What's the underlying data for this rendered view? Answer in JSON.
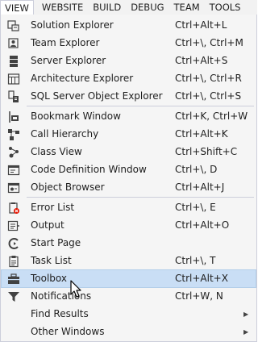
{
  "menubar": {
    "view": "VIEW",
    "website": "WEBSITE",
    "build": "BUILD",
    "debug": "DEBUG",
    "team": "TEAM",
    "tools": "TOOLS"
  },
  "menu": {
    "items": [
      {
        "label": "Solution Explorer",
        "shortcut": "Ctrl+Alt+L",
        "icon": "solution-explorer-icon"
      },
      {
        "label": "Team Explorer",
        "shortcut": "Ctrl+\\, Ctrl+M",
        "icon": "team-explorer-icon"
      },
      {
        "label": "Server Explorer",
        "shortcut": "Ctrl+Alt+S",
        "icon": "server-explorer-icon"
      },
      {
        "label": "Architecture Explorer",
        "shortcut": "Ctrl+\\, Ctrl+R",
        "icon": "architecture-explorer-icon"
      },
      {
        "label": "SQL Server Object Explorer",
        "shortcut": "Ctrl+\\, Ctrl+S",
        "icon": "sql-server-icon"
      },
      {
        "label": "Bookmark Window",
        "shortcut": "Ctrl+K, Ctrl+W",
        "icon": "bookmark-icon"
      },
      {
        "label": "Call Hierarchy",
        "shortcut": "Ctrl+Alt+K",
        "icon": "call-hierarchy-icon"
      },
      {
        "label": "Class View",
        "shortcut": "Ctrl+Shift+C",
        "icon": "class-view-icon"
      },
      {
        "label": "Code Definition Window",
        "shortcut": "Ctrl+\\, D",
        "icon": "code-definition-icon"
      },
      {
        "label": "Object Browser",
        "shortcut": "Ctrl+Alt+J",
        "icon": "object-browser-icon"
      },
      {
        "label": "Error List",
        "shortcut": "Ctrl+\\, E",
        "icon": "error-list-icon"
      },
      {
        "label": "Output",
        "shortcut": "Ctrl+Alt+O",
        "icon": "output-icon"
      },
      {
        "label": "Start Page",
        "shortcut": "",
        "icon": "start-page-icon"
      },
      {
        "label": "Task List",
        "shortcut": "Ctrl+\\, T",
        "icon": "task-list-icon"
      },
      {
        "label": "Toolbox",
        "shortcut": "Ctrl+Alt+X",
        "icon": "toolbox-icon"
      },
      {
        "label": "Notifications",
        "shortcut": "Ctrl+W, N",
        "icon": "notifications-icon"
      },
      {
        "label": "Find Results",
        "shortcut": "",
        "icon": ""
      },
      {
        "label": "Other Windows",
        "shortcut": "",
        "icon": ""
      }
    ],
    "highlighted": "Toolbox",
    "highlight_color": "#c9def5"
  }
}
